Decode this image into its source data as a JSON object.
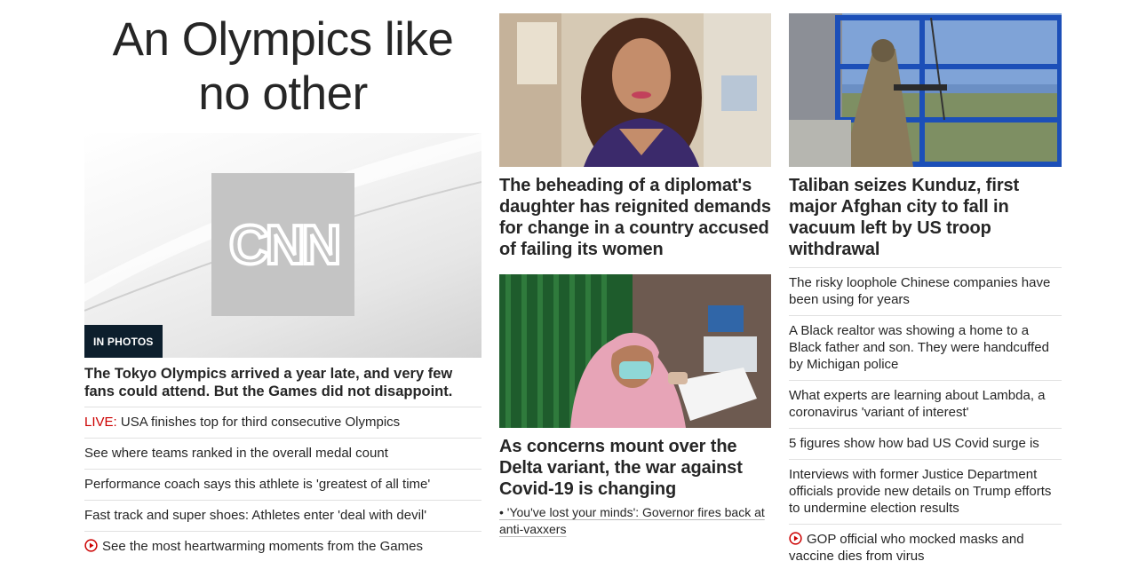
{
  "left": {
    "title": "An Olympics like no other",
    "hero_badge": "IN PHOTOS",
    "hero_logo_text": "CNN",
    "hero_summary": "The Tokyo Olympics arrived a year late, and very few fans could attend. But the Games did not disappoint.",
    "links": [
      {
        "prefix": "LIVE:",
        "text": " USA finishes top for third consecutive Olympics"
      },
      {
        "text": "See where teams ranked in the overall medal count"
      },
      {
        "text": "Performance coach says this athlete is 'greatest of all time'"
      },
      {
        "text": "Fast track and super shoes: Athletes enter 'deal with devil'"
      },
      {
        "icon": "play-video-icon",
        "text": "See the most heartwarming moments from the Games"
      }
    ],
    "colors": {
      "live": "#cc0000",
      "badge": "#0d1f2d"
    }
  },
  "middle": {
    "story1": {
      "headline": "The beheading of a diplomat's daughter has reignited demands for change in a country accused of failing its women"
    },
    "story2": {
      "headline": "As concerns mount over the Delta variant, the war against Covid-19 is changing",
      "related": "• 'You've lost your minds': Governor fires back at anti-vaxxers"
    }
  },
  "right": {
    "story": {
      "headline": "Taliban seizes Kunduz, first major Afghan city to fall in vacuum left by US troop withdrawal"
    },
    "links": [
      {
        "text": "The risky loophole Chinese companies have been using for years"
      },
      {
        "text": "A Black realtor was showing a home to a Black father and son. They were handcuffed by Michigan police"
      },
      {
        "text": "What experts are learning about Lambda, a coronavirus 'variant of interest'"
      },
      {
        "text": "5 figures show how bad US Covid surge is"
      },
      {
        "text": "Interviews with former Justice Department officials provide new details on Trump efforts to undermine election results"
      },
      {
        "icon": "play-video-icon",
        "text": "GOP official who mocked masks and vaccine dies from virus"
      }
    ]
  }
}
